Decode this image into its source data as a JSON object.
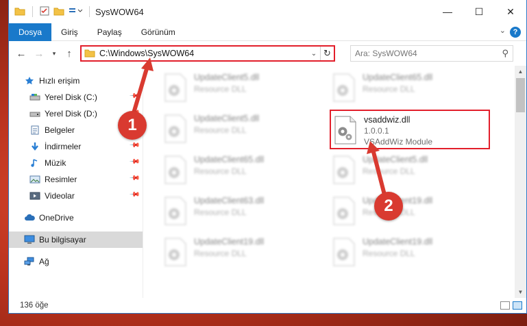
{
  "window": {
    "title": "SysWOW64",
    "minimize_glyph": "—",
    "maximize_glyph": "☐",
    "close_glyph": "✕"
  },
  "ribbon": {
    "tabs": [
      "Dosya",
      "Giriş",
      "Paylaş",
      "Görünüm"
    ],
    "help_glyph": "?"
  },
  "address": {
    "path": "C:\\Windows\\SysWOW64"
  },
  "search": {
    "placeholder": "Ara: SysWOW64"
  },
  "nav": {
    "items": [
      {
        "label": "Hızlı erişim",
        "icon": "star-icon"
      },
      {
        "label": "Yerel Disk (C:)",
        "icon": "drive-icon"
      },
      {
        "label": "Yerel Disk (D:)",
        "icon": "drive-icon"
      },
      {
        "label": "Belgeler",
        "icon": "documents-icon"
      },
      {
        "label": "İndirmeler",
        "icon": "download-icon"
      },
      {
        "label": "Müzik",
        "icon": "music-icon"
      },
      {
        "label": "Resimler",
        "icon": "pictures-icon"
      },
      {
        "label": "Videolar",
        "icon": "videos-icon"
      },
      {
        "label": "OneDrive",
        "icon": "cloud-icon"
      },
      {
        "label": "Bu bilgisayar",
        "icon": "computer-icon"
      },
      {
        "label": "Ağ",
        "icon": "network-icon"
      }
    ]
  },
  "files": [
    {
      "name": "UpdateClient5.dll",
      "sub": "Resource DLL"
    },
    {
      "name": "UpdateClient65.dll",
      "sub": "Resource DLL"
    },
    {
      "name": "UpdateClient5.dll",
      "sub": "Resource DLL"
    },
    {
      "name": "vsaddwiz.dll",
      "sub": "1.0.0.1",
      "sub2": "VSAddWiz Module"
    },
    {
      "name": "UpdateClient65.dll",
      "sub": "Resource DLL"
    },
    {
      "name": "UpdateClient5.dll",
      "sub": "Resource DLL"
    },
    {
      "name": "UpdateClient63.dll",
      "sub": "Resource DLL"
    },
    {
      "name": "UpdateClient19.dll",
      "sub": "Resource DLL"
    },
    {
      "name": "UpdateClient19.dll",
      "sub": "Resource DLL"
    },
    {
      "name": "UpdateClient19.dll",
      "sub": "Resource DLL"
    }
  ],
  "status": {
    "count": "136 öğe"
  },
  "callouts": [
    "1",
    "2"
  ],
  "colors": {
    "accent": "#1979ca",
    "highlight": "#e21e2a",
    "callout": "#d93a30"
  }
}
